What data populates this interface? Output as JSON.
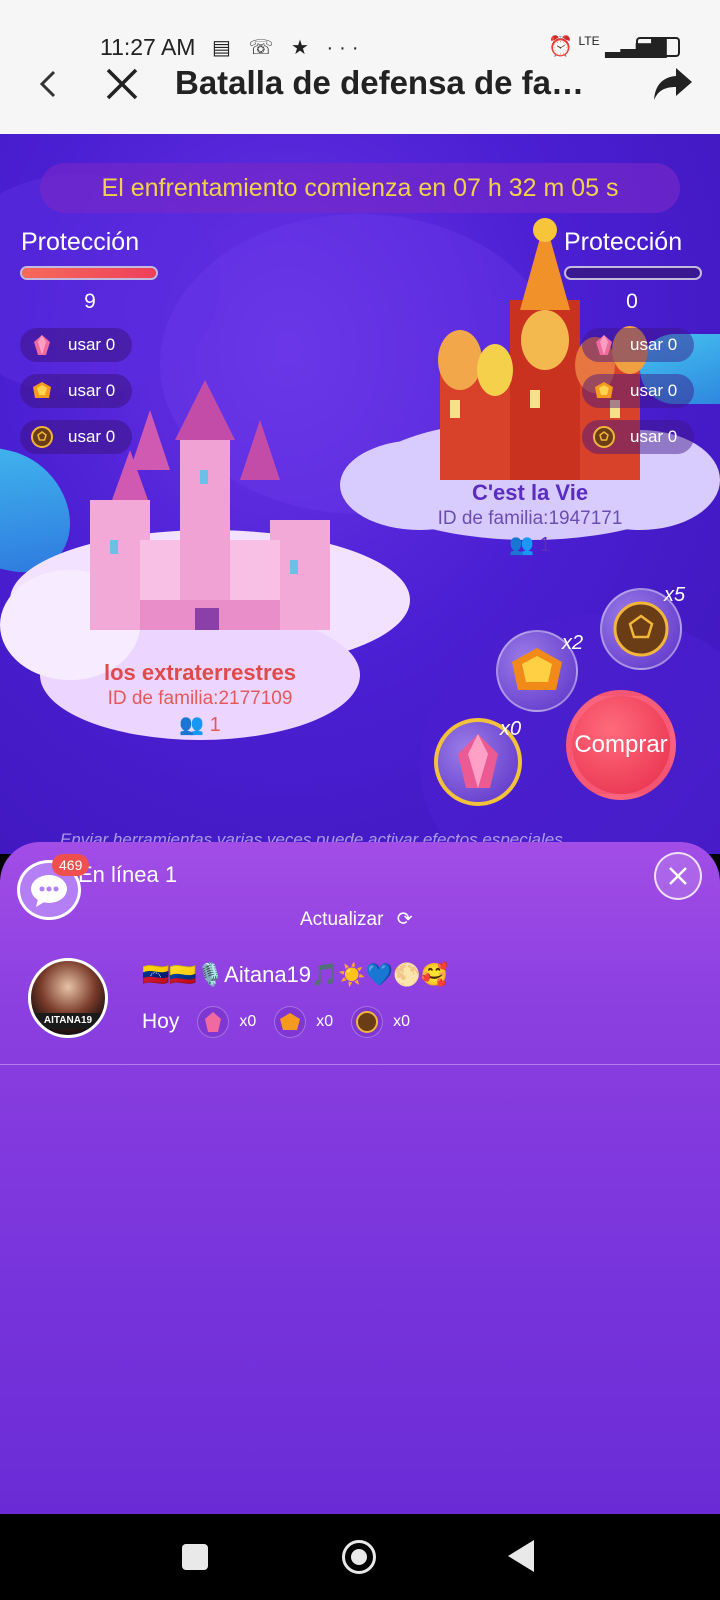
{
  "status_bar": {
    "time": "11:27 AM",
    "icons": "▤ ☏ ★ ···",
    "network": "LTE",
    "battery": "95"
  },
  "header": {
    "title": "Batalla de defensa de fa…"
  },
  "game": {
    "countdown": "El enfrentamiento comienza en 07 h 32 m 05 s",
    "left_team": {
      "protection_label": "Protección",
      "protection_count": "9",
      "protection_fill": 1.0,
      "tools": [
        {
          "icon": "crystal-icon",
          "label": "usar 0"
        },
        {
          "icon": "shield-gem-icon",
          "label": "usar 0"
        },
        {
          "icon": "golden-ball-icon",
          "label": "usar 0"
        }
      ],
      "family_name": "los extraterrestres",
      "family_id": "ID de familia:2177109",
      "members": "1"
    },
    "right_team": {
      "protection_label": "Protección",
      "protection_count": "0",
      "protection_fill": 0.0,
      "tools": [
        {
          "icon": "crystal-icon",
          "label": "usar 0"
        },
        {
          "icon": "shield-gem-icon",
          "label": "usar 0"
        },
        {
          "icon": "golden-ball-icon",
          "label": "usar 0"
        }
      ],
      "family_name": "C'est la Vie",
      "family_id": "ID de familia:1947171",
      "members": "1"
    },
    "shop": {
      "crystal_mult": "x0",
      "gem_mult": "x2",
      "ball_mult": "x5",
      "buy_label": "Comprar"
    },
    "hint": "Enviar herramientas varias veces puede activar efectos especiales"
  },
  "panel": {
    "title": "En línea 1",
    "chat_badge": "469",
    "refresh_label": "Actualizar",
    "user": {
      "name": "🇻🇪🇨🇴🎙️Aitana19🎵☀️💙🌕🥰",
      "avatar_caption": "AITANA19",
      "today_label": "Hoy",
      "counts": [
        "x0",
        "x0",
        "x0"
      ]
    }
  },
  "colors": {
    "accent_red": "#f0525a",
    "panel_purple": "#9b48e4",
    "countdown_gold": "#f3d24b"
  }
}
